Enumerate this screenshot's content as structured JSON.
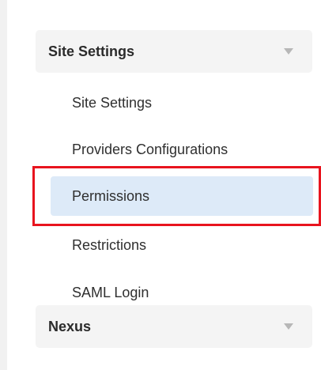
{
  "sections": [
    {
      "title": "Site Settings",
      "expanded": true,
      "items": [
        {
          "label": "Site Settings"
        },
        {
          "label": "Providers Configurations"
        },
        {
          "label": "Permissions",
          "active": true
        },
        {
          "label": "Restrictions"
        },
        {
          "label": "SAML Login"
        }
      ]
    },
    {
      "title": "Nexus",
      "expanded": false
    }
  ],
  "icons": {
    "section_toggle": "chevron-down-icon"
  },
  "colors": {
    "active_item_bg": "#ddeaf8",
    "highlight_border": "#e8141e",
    "header_bg": "#f4f4f4",
    "text": "#2f2f2f"
  }
}
